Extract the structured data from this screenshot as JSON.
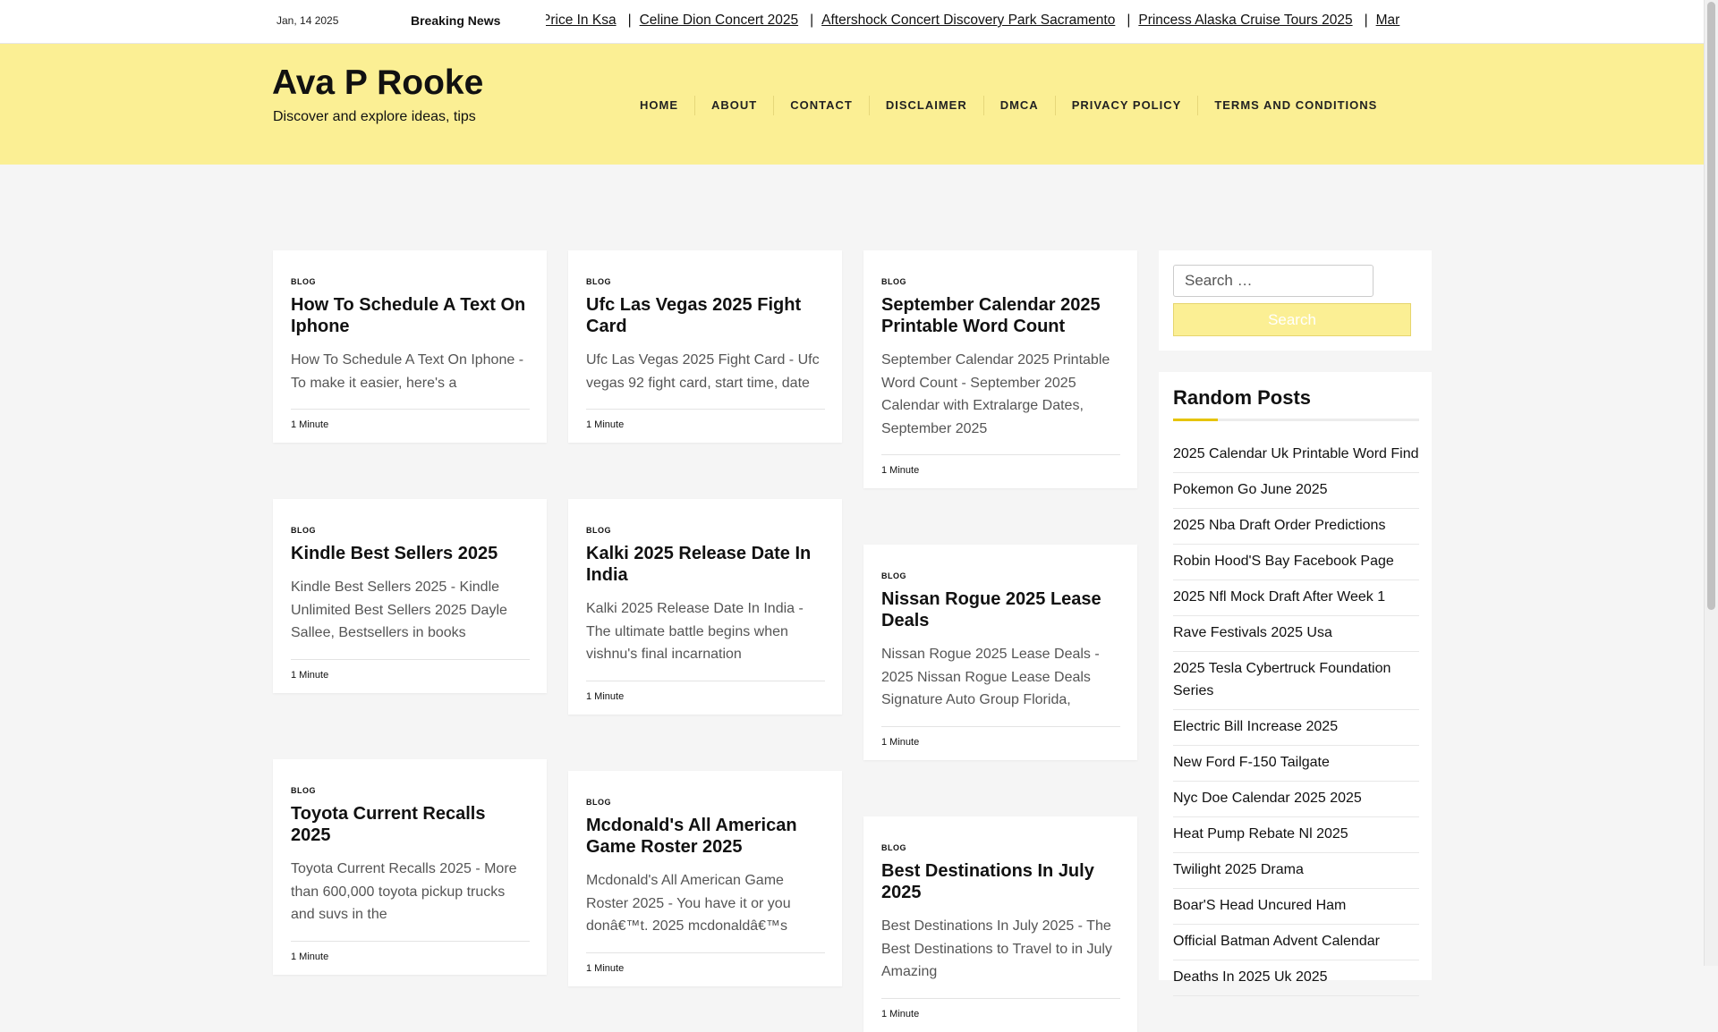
{
  "topbar": {
    "date": "Jan, 14 2025",
    "breaking_label": "Breaking News",
    "ticker": [
      "Price In Ksa",
      "Celine Dion Concert 2025",
      "Aftershock Concert Discovery Park Sacramento",
      "Princess Alaska Cruise Tours 2025",
      "Mar"
    ]
  },
  "header": {
    "site_title": "Ava P Rooke",
    "tagline": "Discover and explore ideas, tips",
    "nav": [
      "HOME",
      "ABOUT",
      "CONTACT",
      "DISCLAIMER",
      "DMCA",
      "PRIVACY POLICY",
      "TERMS AND CONDITIONS"
    ]
  },
  "posts": [
    {
      "category": "BLOG",
      "title": "How To Schedule A Text On Iphone",
      "excerpt": "How To Schedule A Text On Iphone - To make it easier, here's a",
      "read_time": "1 Minute"
    },
    {
      "category": "BLOG",
      "title": "Ufc Las Vegas 2025 Fight Card",
      "excerpt": "Ufc Las Vegas 2025 Fight Card - Ufc vegas 92 fight card, start time, date",
      "read_time": "1 Minute"
    },
    {
      "category": "BLOG",
      "title": "September Calendar 2025 Printable Word Count",
      "excerpt": "September Calendar 2025 Printable Word Count - September 2025 Calendar with Extralarge Dates, September 2025",
      "read_time": "1 Minute"
    },
    {
      "category": "BLOG",
      "title": "Kindle Best Sellers 2025",
      "excerpt": "Kindle Best Sellers 2025 - Kindle Unlimited Best Sellers 2025 Dayle Sallee, Bestsellers in books",
      "read_time": "1 Minute"
    },
    {
      "category": "BLOG",
      "title": "Kalki 2025 Release Date In India",
      "excerpt": "Kalki 2025 Release Date In India - The ultimate battle begins when vishnu's final incarnation",
      "read_time": "1 Minute"
    },
    {
      "category": "BLOG",
      "title": "Nissan Rogue 2025 Lease Deals",
      "excerpt": "Nissan Rogue 2025 Lease Deals - 2025 Nissan Rogue Lease Deals Signature Auto Group Florida,",
      "read_time": "1 Minute"
    },
    {
      "category": "BLOG",
      "title": "Toyota Current Recalls 2025",
      "excerpt": "Toyota Current Recalls 2025 - More than 600,000 toyota pickup trucks and suvs in the",
      "read_time": "1 Minute"
    },
    {
      "category": "BLOG",
      "title": "Mcdonald's All American Game Roster 2025",
      "excerpt": "Mcdonald's All American Game Roster 2025 - You have it or you donâ€™t. 2025 mcdonaldâ€™s",
      "read_time": "1 Minute"
    },
    {
      "category": "BLOG",
      "title": "Best Destinations In July 2025",
      "excerpt": "Best Destinations In July 2025 - The Best Destinations to Travel to in July Amazing",
      "read_time": "1 Minute"
    }
  ],
  "sidebar": {
    "search_placeholder": "Search …",
    "search_button": "Search",
    "random_title": "Random Posts",
    "random_posts": [
      "2025 Calendar Uk Printable Word Find",
      "Pokemon Go June 2025",
      "2025 Nba Draft Order Predictions",
      "Robin Hood'S Bay Facebook Page",
      "2025 Nfl Mock Draft After Week 1",
      "Rave Festivals 2025 Usa",
      "2025 Tesla Cybertruck Foundation Series",
      "Electric Bill Increase 2025",
      "New Ford F-150 Tailgate",
      "Nyc Doe Calendar 2025 2025",
      "Heat Pump Rebate Nl 2025",
      "Twilight 2025 Drama",
      "Boar'S Head Uncured Ham",
      "Official Batman Advent Calendar",
      "Deaths In 2025 Uk 2025"
    ]
  },
  "colors": {
    "header_bg": "#fbef94",
    "accent": "#e6c400",
    "page_bg": "#f5f5f5"
  }
}
